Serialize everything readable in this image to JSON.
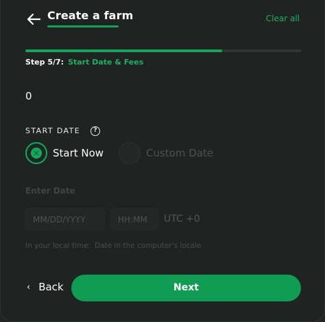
{
  "header": {
    "title": "Create a farm",
    "clear_all_label": "Clear all",
    "back_icon": "arrow-left-icon"
  },
  "progress": {
    "step_text": "Step 5/7:",
    "step_name": "Start Date & Fees",
    "fraction": 0.714
  },
  "fields": {
    "value_display": "0"
  },
  "start_date": {
    "section_label": "START DATE",
    "help_icon": "question-circle-icon",
    "options": [
      {
        "label": "Start Now",
        "selected": true
      },
      {
        "label": "Custom Date",
        "selected": false
      }
    ],
    "enter_date_label": "Enter Date",
    "date_placeholder": "MM/DD/YYYY",
    "time_placeholder": "HH:MM",
    "timezone": "UTC +0",
    "local_time_label": "In your local time:",
    "local_time_value": "Date in the computer's locale"
  },
  "footer": {
    "back_label": "Back",
    "back_chevron": "‹",
    "next_label": "Next"
  },
  "colors": {
    "accent": "#14a35a",
    "background": "#1f2322"
  }
}
